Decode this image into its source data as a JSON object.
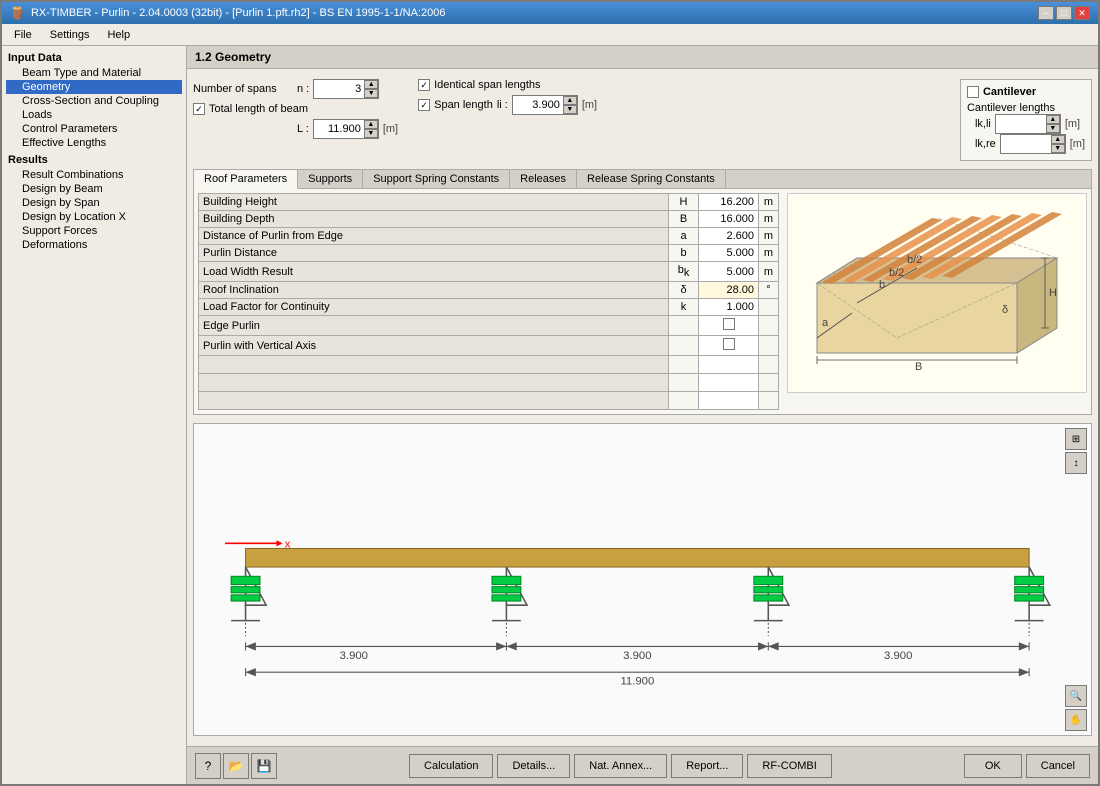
{
  "window": {
    "title": "RX-TIMBER - Purlin - 2.04.0003 (32bit) - [Purlin 1.pft.rh2] - BS EN 1995-1-1/NA:2006",
    "close_label": "✕",
    "min_label": "─",
    "max_label": "□"
  },
  "menu": {
    "items": [
      "File",
      "Settings",
      "Help"
    ]
  },
  "sidebar": {
    "section_input": "Input Data",
    "items_input": [
      {
        "label": "Beam Type and Material",
        "selected": false,
        "indent": 1
      },
      {
        "label": "Geometry",
        "selected": true,
        "indent": 1
      },
      {
        "label": "Cross-Section and Coupling",
        "selected": false,
        "indent": 1
      },
      {
        "label": "Loads",
        "selected": false,
        "indent": 1
      },
      {
        "label": "Control Parameters",
        "selected": false,
        "indent": 1
      },
      {
        "label": "Effective Lengths",
        "selected": false,
        "indent": 1
      }
    ],
    "section_results": "Results",
    "items_results": [
      {
        "label": "Result Combinations",
        "selected": false,
        "indent": 1
      },
      {
        "label": "Design by Beam",
        "selected": false,
        "indent": 1
      },
      {
        "label": "Design by Span",
        "selected": false,
        "indent": 1
      },
      {
        "label": "Design by Location X",
        "selected": false,
        "indent": 1
      },
      {
        "label": "Support Forces",
        "selected": false,
        "indent": 1
      },
      {
        "label": "Deformations",
        "selected": false,
        "indent": 1
      }
    ]
  },
  "section_title": "1.2 Geometry",
  "controls": {
    "num_spans_label": "Number of spans",
    "n_label": "n :",
    "n_value": "3",
    "total_length_label": "Total length of beam",
    "L_label": "L :",
    "L_value": "11.900",
    "L_unit": "[m]",
    "identical_span_label": "Identical span lengths",
    "span_length_label": "Span length",
    "li_label": "li :",
    "li_value": "3.900",
    "li_unit": "[m]",
    "cantilever_label": "Cantilever",
    "cantilever_lengths_label": "Cantilever lengths",
    "lk_li_label": "lk,li",
    "lk_li_unit": "[m]",
    "lk_re_label": "lk,re",
    "lk_re_unit": "[m]"
  },
  "tabs": {
    "items": [
      "Roof Parameters",
      "Supports",
      "Support Spring Constants",
      "Releases",
      "Release Spring Constants"
    ],
    "active": "Roof Parameters"
  },
  "table": {
    "rows": [
      {
        "label": "Building Height",
        "symbol": "H",
        "value": "16.200",
        "unit": "m"
      },
      {
        "label": "Building Depth",
        "symbol": "B",
        "value": "16.000",
        "unit": "m"
      },
      {
        "label": "Distance of Purlin from Edge",
        "symbol": "a",
        "value": "2.600",
        "unit": "m"
      },
      {
        "label": "Purlin Distance",
        "symbol": "b",
        "value": "5.000",
        "unit": "m"
      },
      {
        "label": "Load Width Result",
        "symbol": "bk",
        "value": "5.000",
        "unit": "m"
      },
      {
        "label": "Roof Inclination",
        "symbol": "δ",
        "value": "28.00",
        "unit": "°"
      },
      {
        "label": "Load Factor for Continuity",
        "symbol": "k",
        "value": "1.000",
        "unit": ""
      },
      {
        "label": "Edge Purlin",
        "symbol": "",
        "value": "",
        "unit": "",
        "checkbox": true
      },
      {
        "label": "Purlin with Vertical Axis",
        "symbol": "",
        "value": "",
        "unit": "",
        "checkbox": true
      }
    ]
  },
  "diagram": {
    "span1": "3.900",
    "span2": "3.900",
    "span3": "3.900",
    "total": "11.900"
  },
  "bottom_buttons": {
    "calculation": "Calculation",
    "details": "Details...",
    "nat_annex": "Nat. Annex...",
    "report": "Report...",
    "rf_combi": "RF-COMBI",
    "ok": "OK",
    "cancel": "Cancel"
  }
}
